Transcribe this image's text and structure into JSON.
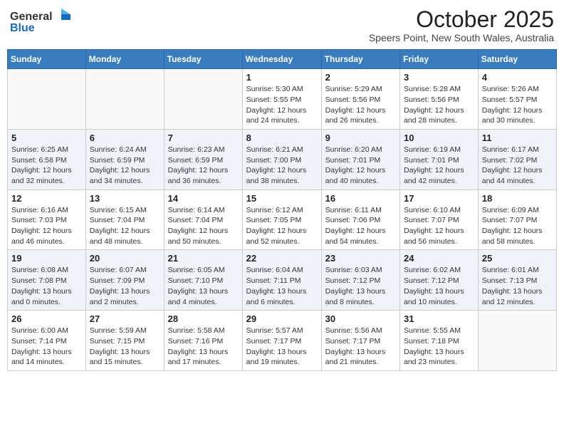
{
  "logo": {
    "line1": "General",
    "line2": "Blue"
  },
  "title": "October 2025",
  "location": "Speers Point, New South Wales, Australia",
  "days_header": [
    "Sunday",
    "Monday",
    "Tuesday",
    "Wednesday",
    "Thursday",
    "Friday",
    "Saturday"
  ],
  "weeks": [
    [
      {
        "num": "",
        "info": ""
      },
      {
        "num": "",
        "info": ""
      },
      {
        "num": "",
        "info": ""
      },
      {
        "num": "1",
        "info": "Sunrise: 5:30 AM\nSunset: 5:55 PM\nDaylight: 12 hours\nand 24 minutes."
      },
      {
        "num": "2",
        "info": "Sunrise: 5:29 AM\nSunset: 5:56 PM\nDaylight: 12 hours\nand 26 minutes."
      },
      {
        "num": "3",
        "info": "Sunrise: 5:28 AM\nSunset: 5:56 PM\nDaylight: 12 hours\nand 28 minutes."
      },
      {
        "num": "4",
        "info": "Sunrise: 5:26 AM\nSunset: 5:57 PM\nDaylight: 12 hours\nand 30 minutes."
      }
    ],
    [
      {
        "num": "5",
        "info": "Sunrise: 6:25 AM\nSunset: 6:58 PM\nDaylight: 12 hours\nand 32 minutes."
      },
      {
        "num": "6",
        "info": "Sunrise: 6:24 AM\nSunset: 6:59 PM\nDaylight: 12 hours\nand 34 minutes."
      },
      {
        "num": "7",
        "info": "Sunrise: 6:23 AM\nSunset: 6:59 PM\nDaylight: 12 hours\nand 36 minutes."
      },
      {
        "num": "8",
        "info": "Sunrise: 6:21 AM\nSunset: 7:00 PM\nDaylight: 12 hours\nand 38 minutes."
      },
      {
        "num": "9",
        "info": "Sunrise: 6:20 AM\nSunset: 7:01 PM\nDaylight: 12 hours\nand 40 minutes."
      },
      {
        "num": "10",
        "info": "Sunrise: 6:19 AM\nSunset: 7:01 PM\nDaylight: 12 hours\nand 42 minutes."
      },
      {
        "num": "11",
        "info": "Sunrise: 6:17 AM\nSunset: 7:02 PM\nDaylight: 12 hours\nand 44 minutes."
      }
    ],
    [
      {
        "num": "12",
        "info": "Sunrise: 6:16 AM\nSunset: 7:03 PM\nDaylight: 12 hours\nand 46 minutes."
      },
      {
        "num": "13",
        "info": "Sunrise: 6:15 AM\nSunset: 7:04 PM\nDaylight: 12 hours\nand 48 minutes."
      },
      {
        "num": "14",
        "info": "Sunrise: 6:14 AM\nSunset: 7:04 PM\nDaylight: 12 hours\nand 50 minutes."
      },
      {
        "num": "15",
        "info": "Sunrise: 6:12 AM\nSunset: 7:05 PM\nDaylight: 12 hours\nand 52 minutes."
      },
      {
        "num": "16",
        "info": "Sunrise: 6:11 AM\nSunset: 7:06 PM\nDaylight: 12 hours\nand 54 minutes."
      },
      {
        "num": "17",
        "info": "Sunrise: 6:10 AM\nSunset: 7:07 PM\nDaylight: 12 hours\nand 56 minutes."
      },
      {
        "num": "18",
        "info": "Sunrise: 6:09 AM\nSunset: 7:07 PM\nDaylight: 12 hours\nand 58 minutes."
      }
    ],
    [
      {
        "num": "19",
        "info": "Sunrise: 6:08 AM\nSunset: 7:08 PM\nDaylight: 13 hours\nand 0 minutes."
      },
      {
        "num": "20",
        "info": "Sunrise: 6:07 AM\nSunset: 7:09 PM\nDaylight: 13 hours\nand 2 minutes."
      },
      {
        "num": "21",
        "info": "Sunrise: 6:05 AM\nSunset: 7:10 PM\nDaylight: 13 hours\nand 4 minutes."
      },
      {
        "num": "22",
        "info": "Sunrise: 6:04 AM\nSunset: 7:11 PM\nDaylight: 13 hours\nand 6 minutes."
      },
      {
        "num": "23",
        "info": "Sunrise: 6:03 AM\nSunset: 7:12 PM\nDaylight: 13 hours\nand 8 minutes."
      },
      {
        "num": "24",
        "info": "Sunrise: 6:02 AM\nSunset: 7:12 PM\nDaylight: 13 hours\nand 10 minutes."
      },
      {
        "num": "25",
        "info": "Sunrise: 6:01 AM\nSunset: 7:13 PM\nDaylight: 13 hours\nand 12 minutes."
      }
    ],
    [
      {
        "num": "26",
        "info": "Sunrise: 6:00 AM\nSunset: 7:14 PM\nDaylight: 13 hours\nand 14 minutes."
      },
      {
        "num": "27",
        "info": "Sunrise: 5:59 AM\nSunset: 7:15 PM\nDaylight: 13 hours\nand 15 minutes."
      },
      {
        "num": "28",
        "info": "Sunrise: 5:58 AM\nSunset: 7:16 PM\nDaylight: 13 hours\nand 17 minutes."
      },
      {
        "num": "29",
        "info": "Sunrise: 5:57 AM\nSunset: 7:17 PM\nDaylight: 13 hours\nand 19 minutes."
      },
      {
        "num": "30",
        "info": "Sunrise: 5:56 AM\nSunset: 7:17 PM\nDaylight: 13 hours\nand 21 minutes."
      },
      {
        "num": "31",
        "info": "Sunrise: 5:55 AM\nSunset: 7:18 PM\nDaylight: 13 hours\nand 23 minutes."
      },
      {
        "num": "",
        "info": ""
      }
    ]
  ]
}
